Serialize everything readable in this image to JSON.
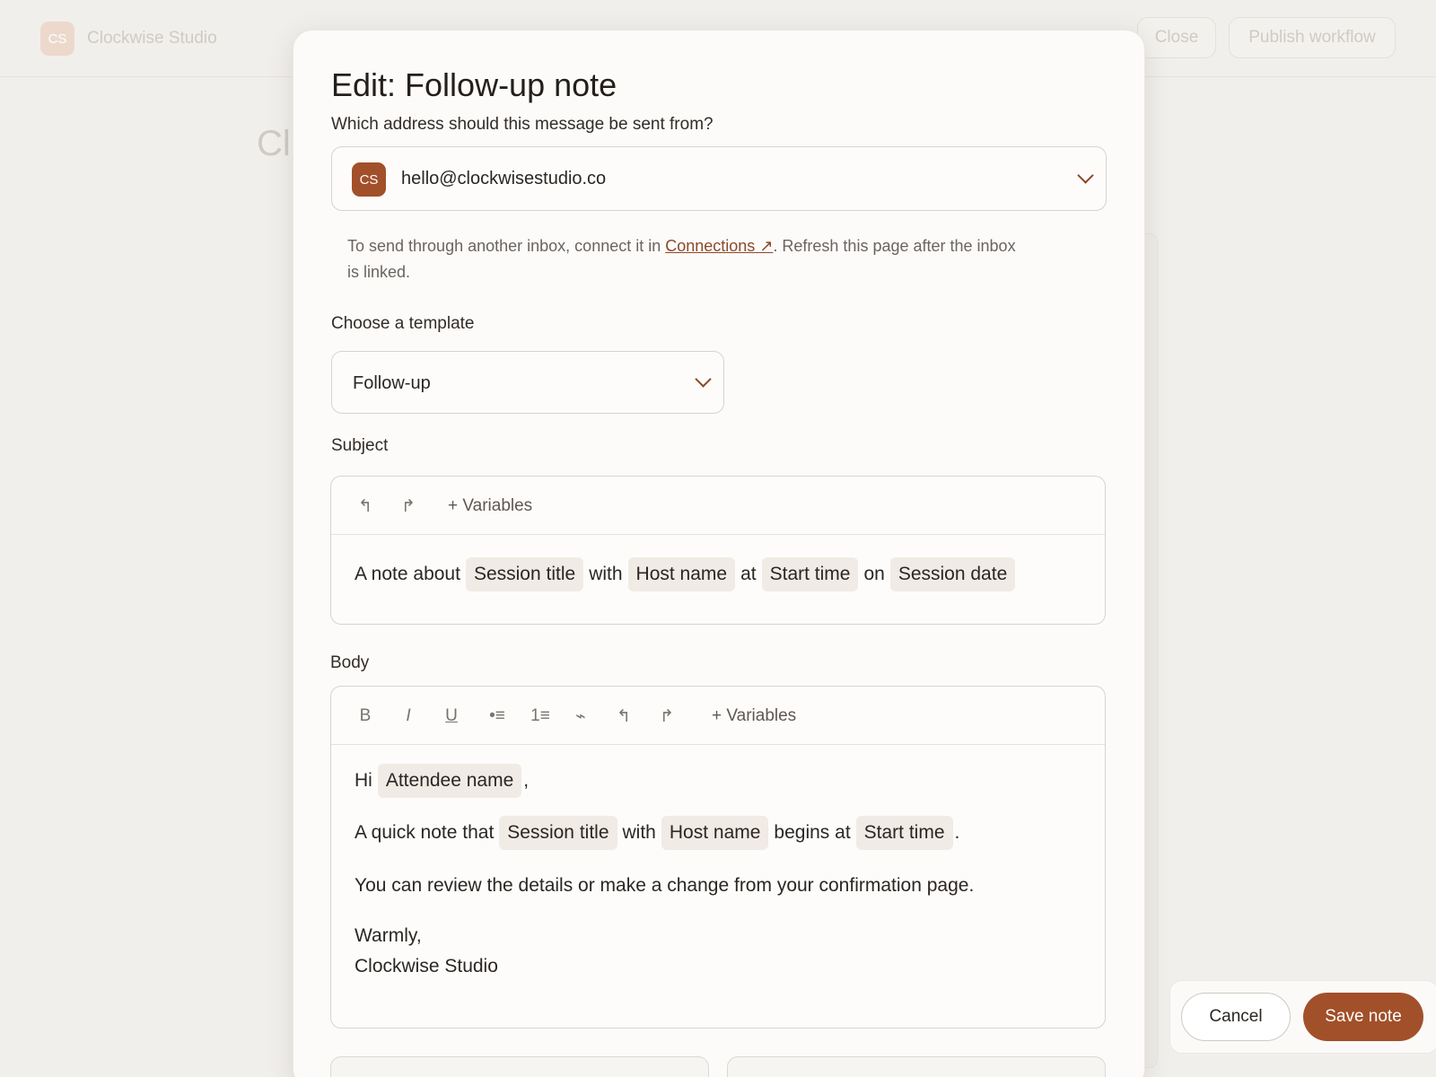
{
  "background": {
    "logo_initials": "CS",
    "brand_name": "Clockwise Studio",
    "close_label": "Close",
    "publish_label": "Publish workflow",
    "title_fragment": "Cl"
  },
  "modal": {
    "title": "Edit: Follow-up note",
    "sender": {
      "label": "Which address should this message be sent from?",
      "avatar_initials": "CS",
      "email": "hello@clockwisestudio.co",
      "helper_prefix": "To send through another inbox, connect it in ",
      "helper_link": "Connections",
      "helper_suffix": ". Refresh this page after the inbox is linked."
    },
    "template": {
      "label": "Choose a template",
      "value": "Follow-up"
    },
    "subject": {
      "label": "Subject",
      "variables_label": "Variables",
      "text_1": "A note about",
      "chip_1": "Session title",
      "text_2": "with",
      "chip_2": "Host name",
      "text_3": "at",
      "chip_3": "Start time",
      "text_4": "on",
      "chip_4": "Session date"
    },
    "body": {
      "label": "Body",
      "variables_label": "Variables",
      "greeting": "Hi",
      "greeting_chip": "Attendee name",
      "greeting_end": ",",
      "l2_text_1": "A quick note that",
      "l2_chip_1": "Session title",
      "l2_text_2": "with",
      "l2_chip_2": "Host name",
      "l2_text_3": "begins at",
      "l2_chip_3": "Start time",
      "l2_end": ".",
      "l3": "You can review the details or make a change from your confirmation page.",
      "signoff": "Warmly,",
      "signature": "Clockwise Studio"
    }
  },
  "footer": {
    "cancel_label": "Cancel",
    "save_label": "Save note"
  },
  "colors": {
    "accent": "#a2502a",
    "chip_bg": "#f1ebe5"
  }
}
